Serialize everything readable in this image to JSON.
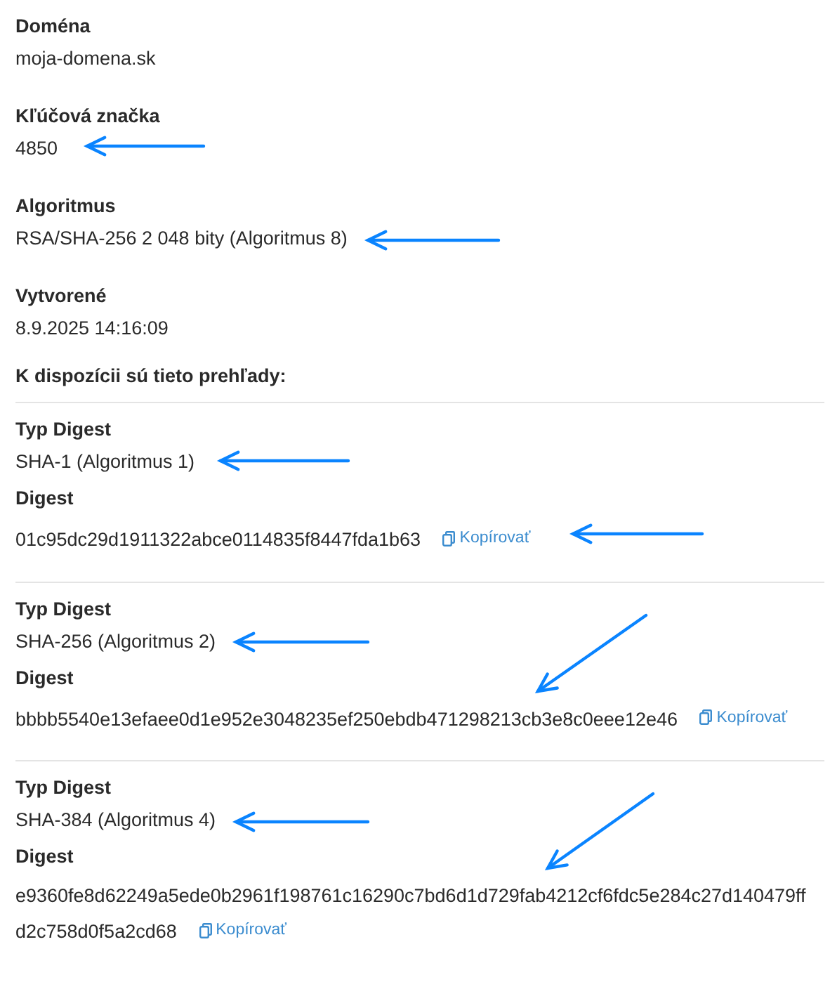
{
  "fields": [
    {
      "label": "Doména",
      "value": "moja-domena.sk"
    },
    {
      "label": "Kľúčová značka",
      "value": "4850"
    },
    {
      "label": "Algoritmus",
      "value": "RSA/SHA-256 2 048 bity (Algoritmus 8)"
    },
    {
      "label": "Vytvorené",
      "value": "8.9.2025 14:16:09"
    }
  ],
  "digests_heading": "K dispozícii sú tieto prehľady:",
  "digests": [
    {
      "type_label": "Typ Digest",
      "type": "SHA-1 (Algoritmus 1)",
      "digest_label": "Digest",
      "digest": "01c95dc29d1911322abce0114835f8447fda1b63",
      "copy": "Kopírovať"
    },
    {
      "type_label": "Typ Digest",
      "type": "SHA-256 (Algoritmus 2)",
      "digest_label": "Digest",
      "digest": "bbbb5540e13efaee0d1e952e3048235ef250ebdb471298213cb3e8c0eee12e46",
      "copy": "Kopírovať"
    },
    {
      "type_label": "Typ Digest",
      "type": "SHA-384 (Algoritmus 4)",
      "digest_label": "Digest",
      "digest": "e9360fe8d62249a5ede0b2961f198761c16290c7bd6d1d729fab4212cf6fdc5e284c27d140479ffd2c758d0f5a2cd68",
      "copy": "Kopírovať"
    }
  ]
}
